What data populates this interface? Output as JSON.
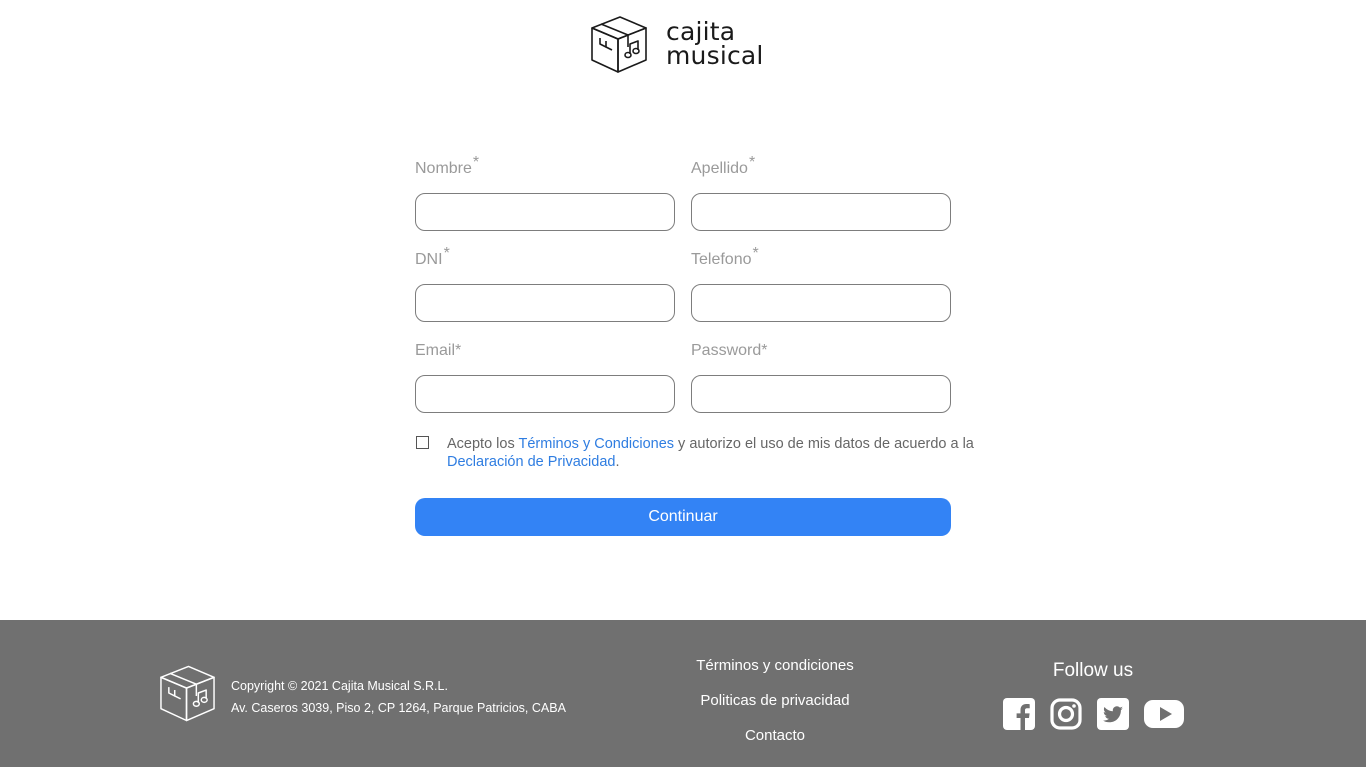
{
  "brand": {
    "name_line1": "cajita",
    "name_line2": "musical"
  },
  "form": {
    "fields": [
      {
        "label": "Nombre",
        "required": "*",
        "value": ""
      },
      {
        "label": "Apellido",
        "required": "*",
        "value": ""
      },
      {
        "label": "DNI",
        "required": "*",
        "value": ""
      },
      {
        "label": "Telefono",
        "required": "*",
        "value": ""
      },
      {
        "label": "Email",
        "required": "*",
        "value": ""
      },
      {
        "label": "Password",
        "required": "*",
        "value": ""
      }
    ],
    "terms": {
      "checked": false,
      "prefix": "Acepto los ",
      "terms_link": "Términos y Condiciones",
      "middle": " y autorizo el uso de mis datos de acuerdo a la ",
      "privacy_link": "Declaración de Privacidad",
      "suffix": "."
    },
    "submit_label": "Continuar"
  },
  "footer": {
    "copyright": "Copyright © 2021 Cajita Musical S.R.L.",
    "address": "Av. Caseros 3039, Piso 2, CP 1264, Parque Patricios, CABA",
    "links": [
      "Términos y condiciones",
      "Politicas de privacidad",
      "Contacto"
    ],
    "follow_us": "Follow us",
    "social_icons": [
      "facebook-icon",
      "instagram-icon",
      "twitter-icon",
      "youtube-icon"
    ]
  },
  "colors": {
    "primary": "#3383f5",
    "link": "#2f7de1",
    "footer_bg": "#707070"
  }
}
